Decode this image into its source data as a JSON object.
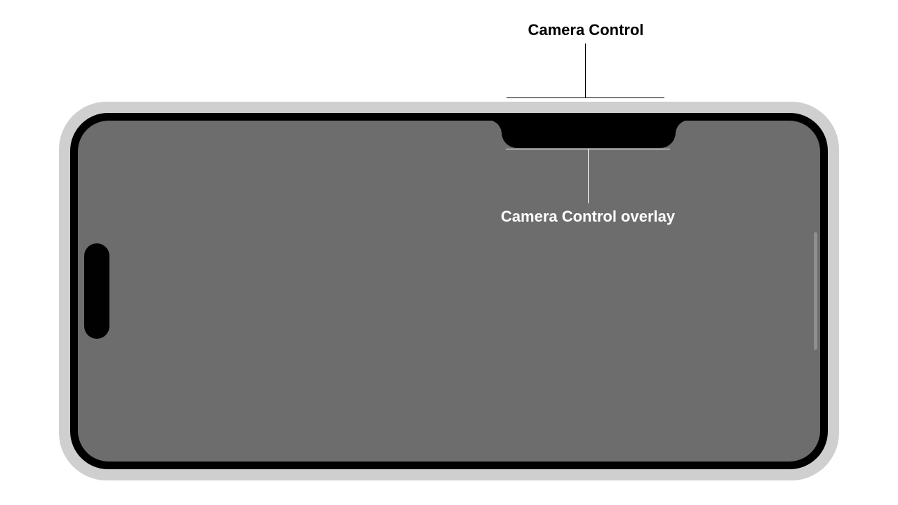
{
  "callouts": {
    "camera_control": "Camera Control",
    "camera_control_overlay": "Camera Control overlay"
  }
}
